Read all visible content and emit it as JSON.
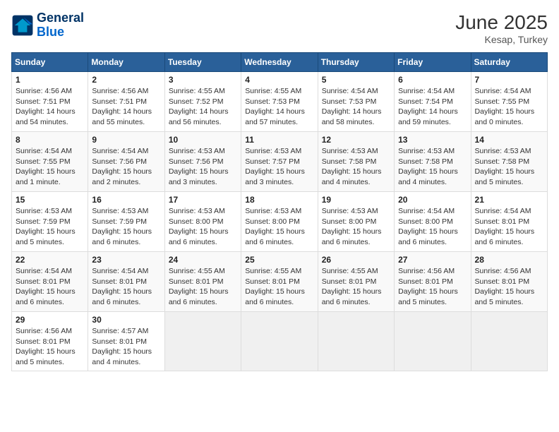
{
  "header": {
    "logo_line1": "General",
    "logo_line2": "Blue",
    "month": "June 2025",
    "location": "Kesap, Turkey"
  },
  "days_of_week": [
    "Sunday",
    "Monday",
    "Tuesday",
    "Wednesday",
    "Thursday",
    "Friday",
    "Saturday"
  ],
  "weeks": [
    [
      {
        "day": "1",
        "sunrise": "Sunrise: 4:56 AM",
        "sunset": "Sunset: 7:51 PM",
        "daylight": "Daylight: 14 hours and 54 minutes."
      },
      {
        "day": "2",
        "sunrise": "Sunrise: 4:56 AM",
        "sunset": "Sunset: 7:51 PM",
        "daylight": "Daylight: 14 hours and 55 minutes."
      },
      {
        "day": "3",
        "sunrise": "Sunrise: 4:55 AM",
        "sunset": "Sunset: 7:52 PM",
        "daylight": "Daylight: 14 hours and 56 minutes."
      },
      {
        "day": "4",
        "sunrise": "Sunrise: 4:55 AM",
        "sunset": "Sunset: 7:53 PM",
        "daylight": "Daylight: 14 hours and 57 minutes."
      },
      {
        "day": "5",
        "sunrise": "Sunrise: 4:54 AM",
        "sunset": "Sunset: 7:53 PM",
        "daylight": "Daylight: 14 hours and 58 minutes."
      },
      {
        "day": "6",
        "sunrise": "Sunrise: 4:54 AM",
        "sunset": "Sunset: 7:54 PM",
        "daylight": "Daylight: 14 hours and 59 minutes."
      },
      {
        "day": "7",
        "sunrise": "Sunrise: 4:54 AM",
        "sunset": "Sunset: 7:55 PM",
        "daylight": "Daylight: 15 hours and 0 minutes."
      }
    ],
    [
      {
        "day": "8",
        "sunrise": "Sunrise: 4:54 AM",
        "sunset": "Sunset: 7:55 PM",
        "daylight": "Daylight: 15 hours and 1 minute."
      },
      {
        "day": "9",
        "sunrise": "Sunrise: 4:54 AM",
        "sunset": "Sunset: 7:56 PM",
        "daylight": "Daylight: 15 hours and 2 minutes."
      },
      {
        "day": "10",
        "sunrise": "Sunrise: 4:53 AM",
        "sunset": "Sunset: 7:56 PM",
        "daylight": "Daylight: 15 hours and 3 minutes."
      },
      {
        "day": "11",
        "sunrise": "Sunrise: 4:53 AM",
        "sunset": "Sunset: 7:57 PM",
        "daylight": "Daylight: 15 hours and 3 minutes."
      },
      {
        "day": "12",
        "sunrise": "Sunrise: 4:53 AM",
        "sunset": "Sunset: 7:58 PM",
        "daylight": "Daylight: 15 hours and 4 minutes."
      },
      {
        "day": "13",
        "sunrise": "Sunrise: 4:53 AM",
        "sunset": "Sunset: 7:58 PM",
        "daylight": "Daylight: 15 hours and 4 minutes."
      },
      {
        "day": "14",
        "sunrise": "Sunrise: 4:53 AM",
        "sunset": "Sunset: 7:58 PM",
        "daylight": "Daylight: 15 hours and 5 minutes."
      }
    ],
    [
      {
        "day": "15",
        "sunrise": "Sunrise: 4:53 AM",
        "sunset": "Sunset: 7:59 PM",
        "daylight": "Daylight: 15 hours and 5 minutes."
      },
      {
        "day": "16",
        "sunrise": "Sunrise: 4:53 AM",
        "sunset": "Sunset: 7:59 PM",
        "daylight": "Daylight: 15 hours and 6 minutes."
      },
      {
        "day": "17",
        "sunrise": "Sunrise: 4:53 AM",
        "sunset": "Sunset: 8:00 PM",
        "daylight": "Daylight: 15 hours and 6 minutes."
      },
      {
        "day": "18",
        "sunrise": "Sunrise: 4:53 AM",
        "sunset": "Sunset: 8:00 PM",
        "daylight": "Daylight: 15 hours and 6 minutes."
      },
      {
        "day": "19",
        "sunrise": "Sunrise: 4:53 AM",
        "sunset": "Sunset: 8:00 PM",
        "daylight": "Daylight: 15 hours and 6 minutes."
      },
      {
        "day": "20",
        "sunrise": "Sunrise: 4:54 AM",
        "sunset": "Sunset: 8:00 PM",
        "daylight": "Daylight: 15 hours and 6 minutes."
      },
      {
        "day": "21",
        "sunrise": "Sunrise: 4:54 AM",
        "sunset": "Sunset: 8:01 PM",
        "daylight": "Daylight: 15 hours and 6 minutes."
      }
    ],
    [
      {
        "day": "22",
        "sunrise": "Sunrise: 4:54 AM",
        "sunset": "Sunset: 8:01 PM",
        "daylight": "Daylight: 15 hours and 6 minutes."
      },
      {
        "day": "23",
        "sunrise": "Sunrise: 4:54 AM",
        "sunset": "Sunset: 8:01 PM",
        "daylight": "Daylight: 15 hours and 6 minutes."
      },
      {
        "day": "24",
        "sunrise": "Sunrise: 4:55 AM",
        "sunset": "Sunset: 8:01 PM",
        "daylight": "Daylight: 15 hours and 6 minutes."
      },
      {
        "day": "25",
        "sunrise": "Sunrise: 4:55 AM",
        "sunset": "Sunset: 8:01 PM",
        "daylight": "Daylight: 15 hours and 6 minutes."
      },
      {
        "day": "26",
        "sunrise": "Sunrise: 4:55 AM",
        "sunset": "Sunset: 8:01 PM",
        "daylight": "Daylight: 15 hours and 6 minutes."
      },
      {
        "day": "27",
        "sunrise": "Sunrise: 4:56 AM",
        "sunset": "Sunset: 8:01 PM",
        "daylight": "Daylight: 15 hours and 5 minutes."
      },
      {
        "day": "28",
        "sunrise": "Sunrise: 4:56 AM",
        "sunset": "Sunset: 8:01 PM",
        "daylight": "Daylight: 15 hours and 5 minutes."
      }
    ],
    [
      {
        "day": "29",
        "sunrise": "Sunrise: 4:56 AM",
        "sunset": "Sunset: 8:01 PM",
        "daylight": "Daylight: 15 hours and 5 minutes."
      },
      {
        "day": "30",
        "sunrise": "Sunrise: 4:57 AM",
        "sunset": "Sunset: 8:01 PM",
        "daylight": "Daylight: 15 hours and 4 minutes."
      },
      null,
      null,
      null,
      null,
      null
    ]
  ]
}
